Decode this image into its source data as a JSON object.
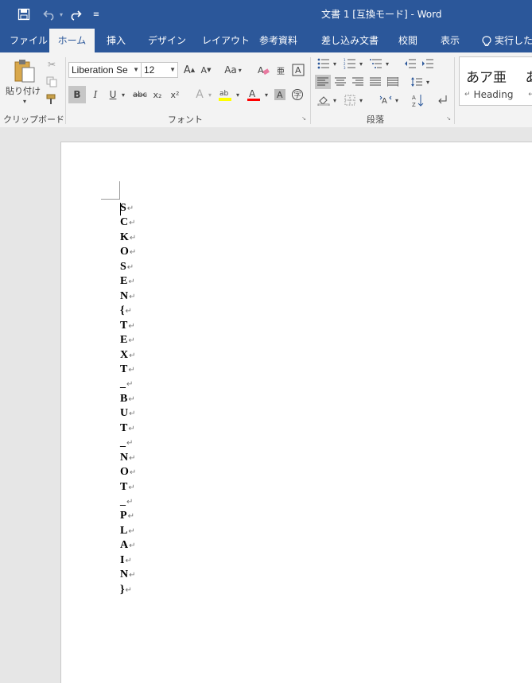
{
  "window": {
    "title": "文書 1 [互換モード]  -  Word"
  },
  "quick_access": {
    "save_icon": "save-icon",
    "undo_icon": "undo-icon",
    "redo_icon": "redo-icon",
    "customize_icon": "customize-qat-icon"
  },
  "tabs": [
    {
      "label": "ファイル"
    },
    {
      "label": "ホーム"
    },
    {
      "label": "挿入"
    },
    {
      "label": "デザイン"
    },
    {
      "label": "レイアウト"
    },
    {
      "label": "参考資料"
    },
    {
      "label": "差し込み文書"
    },
    {
      "label": "校閲"
    },
    {
      "label": "表示"
    },
    {
      "label": "実行したい"
    }
  ],
  "ribbon": {
    "paste_label": "貼り付け",
    "font_name": "Liberation Se",
    "font_size": "12",
    "style_preview": "あア亜",
    "style_name": "Heading",
    "style_name_marker": "↵",
    "groups": {
      "clipboard": "クリップボード",
      "font": "フォント",
      "paragraph": "段落"
    },
    "format_buttons": {
      "bold": "B",
      "italic": "I",
      "underline": "U",
      "strike": "abc",
      "subscript": "x₂",
      "superscript": "x²"
    },
    "grow_font": "A",
    "shrink_font": "A",
    "change_case": "Aa"
  },
  "document": {
    "lines": [
      "S",
      "C",
      "K",
      "O",
      "S",
      "E",
      "N",
      "{",
      "T",
      "E",
      "X",
      "T",
      "_",
      "B",
      "U",
      "T",
      "_",
      "N",
      "O",
      "T",
      "_",
      "P",
      "L",
      "A",
      "I",
      "N",
      "}"
    ],
    "paragraph_mark": "↵"
  },
  "colors": {
    "title_bar": "#2b579a",
    "ribbon": "#f3f3f3",
    "highlight": "#ffff00",
    "font_color": "#ff0000"
  }
}
